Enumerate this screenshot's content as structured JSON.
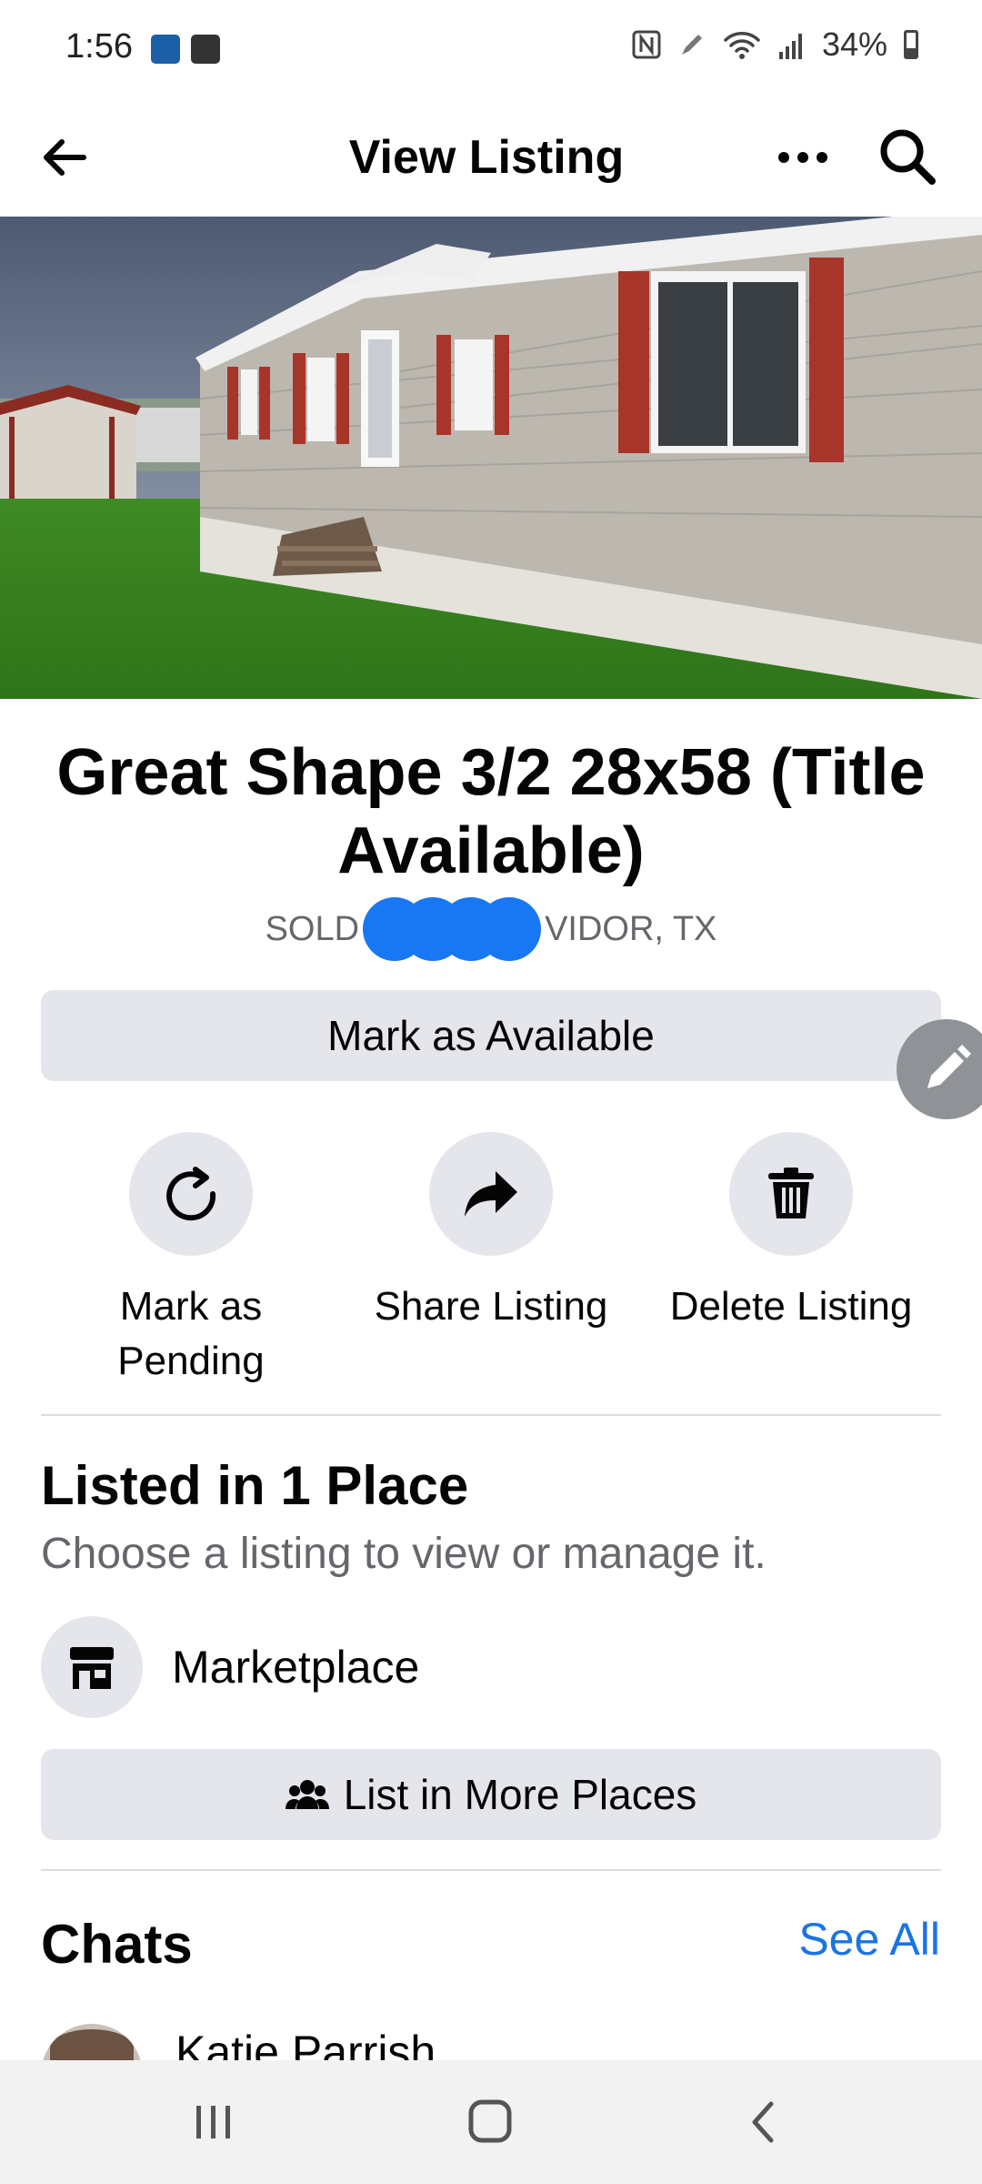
{
  "status_bar": {
    "time": "1:56",
    "battery": "34%"
  },
  "app_bar": {
    "title": "View Listing"
  },
  "listing": {
    "title": "Great Shape 3/2 28x58 (Title Available)",
    "status": "SOLD",
    "location": "VIDOR, TX",
    "photo_alt": "mobile home photo"
  },
  "buttons": {
    "mark_available": "Mark as Available",
    "list_more": "List in More Places"
  },
  "actions": [
    {
      "label": "Mark as Pending",
      "icon": "refresh-icon"
    },
    {
      "label": "Share Listing",
      "icon": "share-arrow-icon"
    },
    {
      "label": "Delete Listing",
      "icon": "trash-icon"
    }
  ],
  "listed_in": {
    "title": "Listed in 1 Place",
    "subtitle": "Choose a listing to view or manage it.",
    "places": [
      {
        "label": "Marketplace",
        "icon": "storefront-icon"
      }
    ]
  },
  "chats": {
    "title": "Chats",
    "see_all": "See All",
    "items": [
      {
        "name": "Katie Parrish"
      }
    ]
  },
  "colors": {
    "accent": "#1b74e4",
    "button_gray": "#e4e6eb",
    "redaction": "#1877f2"
  }
}
